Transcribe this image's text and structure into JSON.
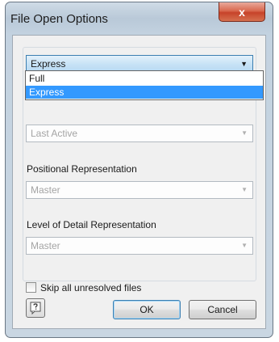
{
  "window": {
    "title": "File Open Options",
    "close_glyph": "x"
  },
  "top_combo": {
    "value": "Express",
    "options": [
      "Full",
      "Express"
    ],
    "selected_index": 1
  },
  "design_view": {
    "value": "Last Active"
  },
  "positional": {
    "label": "Positional Representation",
    "value": "Master"
  },
  "lod": {
    "label": "Level of Detail Representation",
    "value": "Master"
  },
  "skip_checkbox": {
    "label": "Skip all unresolved files",
    "checked": false
  },
  "buttons": {
    "ok": "OK",
    "cancel": "Cancel"
  },
  "icons": {
    "help": "help-icon",
    "close": "close-icon",
    "dropdown": "chevron-down-icon"
  },
  "colors": {
    "selection": "#3399ff",
    "close_button": "#c7432a"
  }
}
